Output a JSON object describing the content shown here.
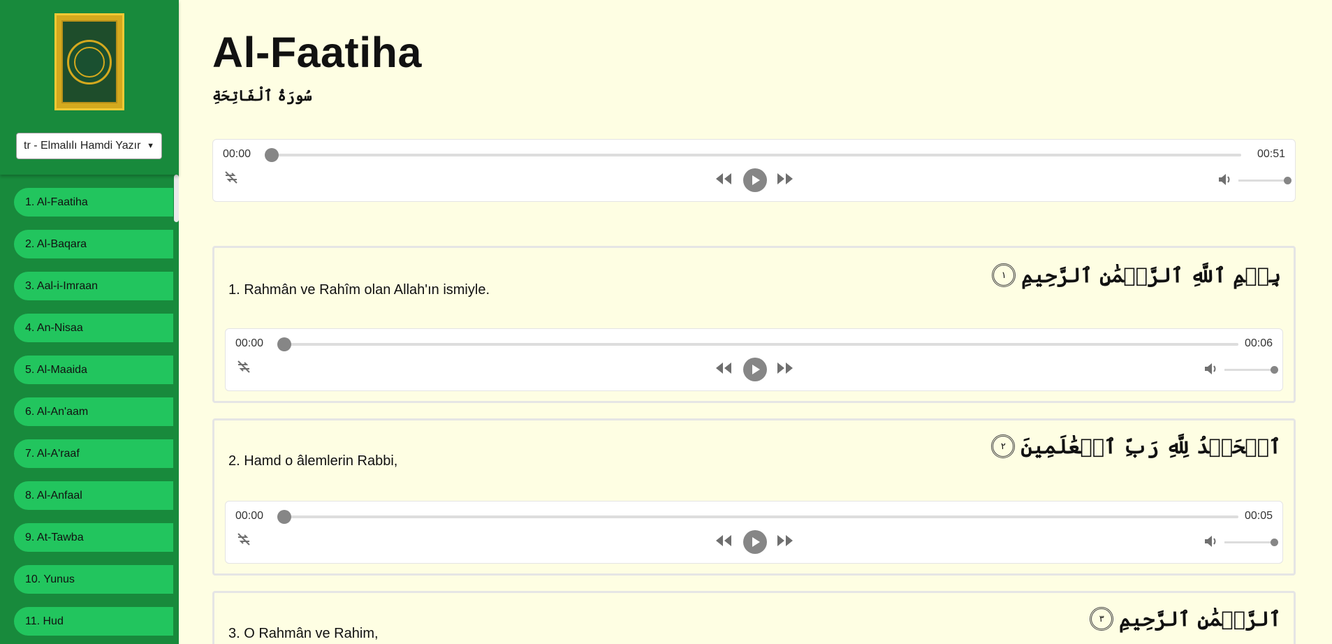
{
  "sidebar": {
    "language": "tr - Elmalılı Hamdi Yazır",
    "logo_text": "القرآن الكريم",
    "surahs": [
      "1. Al-Faatiha",
      "2. Al-Baqara",
      "3. Aal-i-Imraan",
      "4. An-Nisaa",
      "5. Al-Maaida",
      "6. Al-An'aam",
      "7. Al-A'raaf",
      "8. Al-Anfaal",
      "9. At-Tawba",
      "10. Yunus",
      "11. Hud"
    ]
  },
  "main": {
    "title": "Al-Faatiha",
    "arabic_title": "سُورَةُ ٱلْفَاتِحَةِ",
    "player": {
      "current": "00:00",
      "duration": "00:51",
      "progress": 0,
      "volume": 1
    }
  },
  "verses": [
    {
      "text": "1. Rahmân ve Rahîm olan Allah'ın ismiyle.",
      "arabic": "بِسۡمِ ٱللَّهِ ٱلرَّحۡمَٰنِ ٱلرَّحِيمِ",
      "number": "١",
      "current": "00:00",
      "duration": "00:06"
    },
    {
      "text": "2. Hamd o âlemlerin Rabbi,",
      "arabic": "ٱلۡحَمۡدُ لِلَّهِ رَبِّ ٱلۡعَٰلَمِينَ",
      "number": "٢",
      "current": "00:00",
      "duration": "00:05"
    },
    {
      "text": "3. O Rahmân ve Rahim,",
      "arabic": "ٱلرَّحۡمَٰنِ ٱلرَّحِيمِ",
      "number": "٣",
      "current": "",
      "duration": ""
    }
  ],
  "colors": {
    "sidebar": "#188a3c",
    "surah_item": "#22c55e",
    "page_bg": "#fefee3",
    "player_knob": "#868686"
  }
}
